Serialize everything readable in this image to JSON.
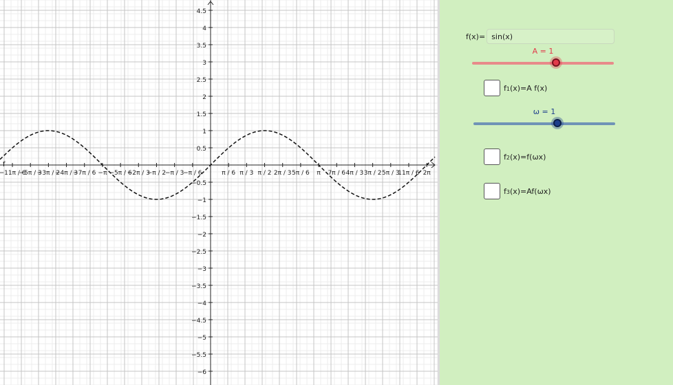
{
  "graph": {
    "function_label": "f",
    "y_ticks": [
      "4.5",
      "4",
      "3.5",
      "3",
      "2.5",
      "2",
      "1.5",
      "1",
      "0.5",
      "−0.5",
      "−1",
      "−1.5",
      "−2",
      "−2.5",
      "−3",
      "−3.5",
      "−4",
      "−4.5",
      "−5",
      "−5.5",
      "−6"
    ],
    "x_ticks": [
      "−11π / 6",
      "−5π / 3",
      "−3π / 2",
      "−4π / 3",
      "−7π / 6",
      "−π",
      "−5π / 6",
      "−2π / 3",
      "−π / 2",
      "−π / 3",
      "−π / 6",
      "π / 6",
      "π / 3",
      "π / 2",
      "2π / 3",
      "5π / 6",
      "π",
      "7π / 6",
      "4π / 3",
      "3π / 2",
      "5π / 3",
      "11π / 6",
      "2π"
    ]
  },
  "panel": {
    "function_input": {
      "label": "f(x)=",
      "value": "sin(x)"
    },
    "slider_a": {
      "label": "A = 1",
      "value": 1,
      "min": -5,
      "max": 1.5,
      "color": "#e23a4a",
      "track_color": "#e88a8a"
    },
    "checkbox_1": {
      "label_main": "f",
      "label_sub": "1",
      "label_rest": "(x)=A f(x)",
      "checked": false
    },
    "slider_omega": {
      "label": "ω = 1",
      "value": 1,
      "min": -5,
      "max": 1.5,
      "color": "#1d3e8c",
      "track_color": "#6f93b6"
    },
    "checkbox_2": {
      "label_main": "f",
      "label_sub": "2",
      "label_rest": "(x)=f(ωx)",
      "checked": false
    },
    "checkbox_3": {
      "label_main": "f",
      "label_sub": "3",
      "label_rest": "(x)=Af(ωx)",
      "checked": false
    }
  }
}
